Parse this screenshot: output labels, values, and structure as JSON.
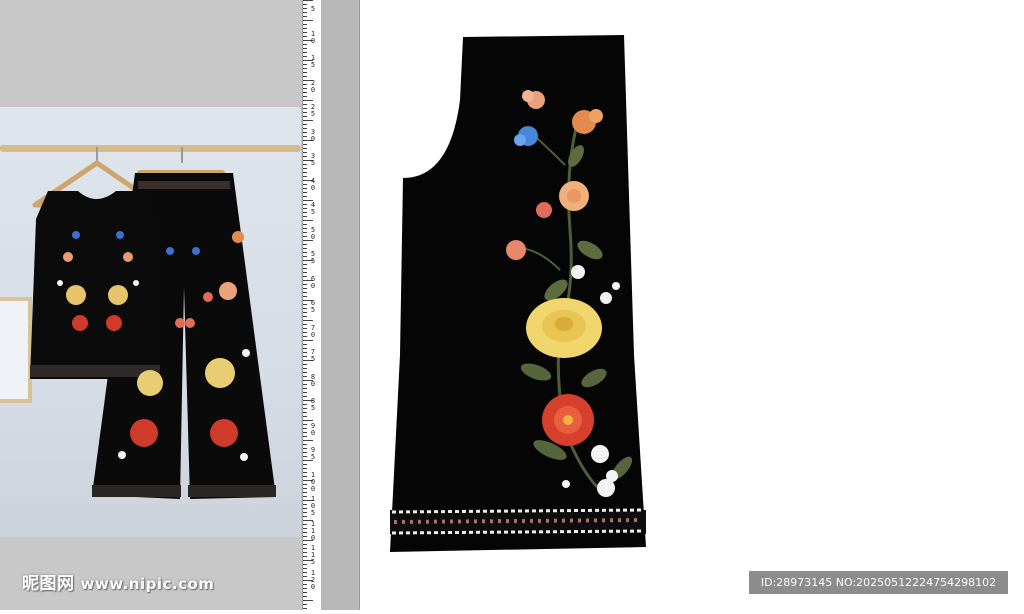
{
  "watermark": {
    "logo_text": "昵图网",
    "site_text": "www.nipic.com",
    "id_text": "ID:28973145 NO:20250512224754298102"
  },
  "ruler": {
    "labels": [
      "5",
      "10",
      "15",
      "20",
      "25",
      "30",
      "35",
      "40",
      "45",
      "50",
      "55",
      "60",
      "65",
      "70",
      "75",
      "80",
      "85",
      "90",
      "95",
      "100",
      "105",
      "110",
      "115",
      "120"
    ]
  },
  "colors": {
    "garment": "#050505",
    "panel_gray": "#c8c8c8",
    "strip_gray": "#b8b8b8",
    "watermark_box": "#8c8c8c",
    "hanger_rail": "#d7b98c"
  },
  "icons": {
    "flowers": [
      "peach-flower-icon",
      "blue-flower-icon",
      "orange-flower-icon",
      "coral-flower-icon",
      "yellow-rose-icon",
      "red-flower-icon",
      "white-flower-icon"
    ]
  }
}
